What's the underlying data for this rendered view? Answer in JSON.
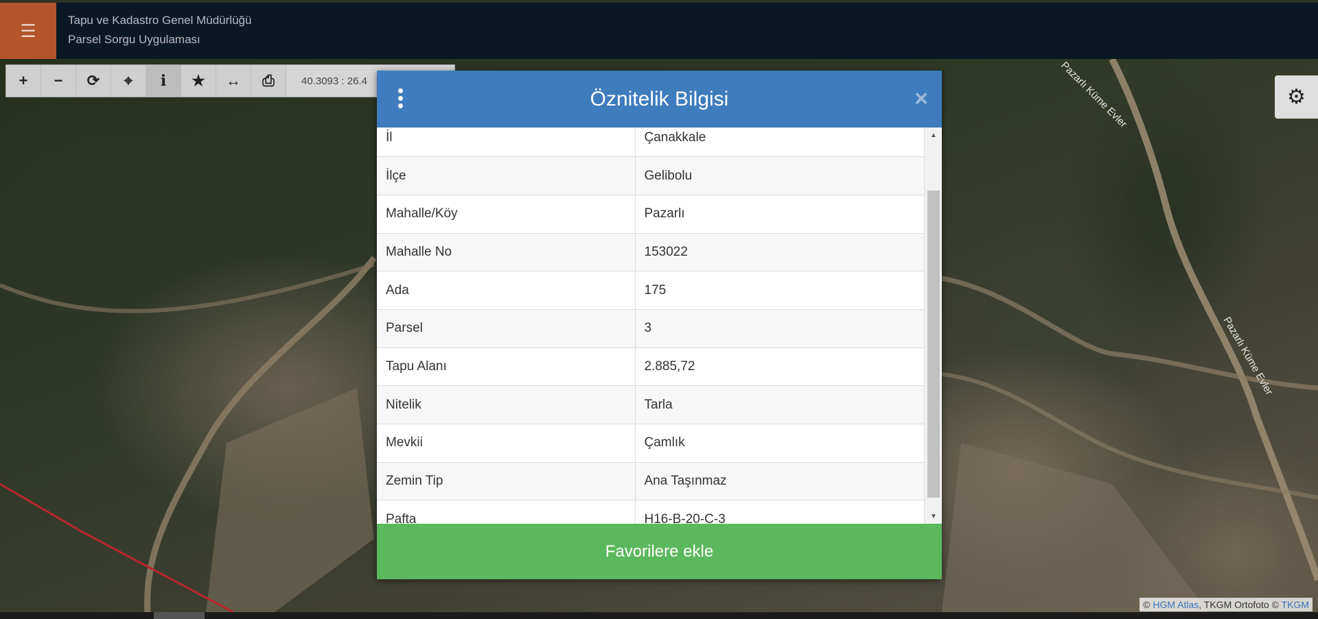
{
  "header": {
    "title_line1": "Tapu ve Kadastro Genel Müdürlüğü",
    "title_line2": "Parsel Sorgu Uygulaması",
    "menu_icon": "hamburger-icon"
  },
  "toolbar": {
    "tools": [
      "zoom-in-icon",
      "zoom-out-icon",
      "refresh-icon",
      "locate-icon",
      "info-icon",
      "favorite-icon",
      "measure-icon",
      "print-icon"
    ],
    "coordinates": "40.3093 : 26.4"
  },
  "settings": {
    "icon": "gear-icon"
  },
  "modal": {
    "title": "Öznitelik Bilgisi",
    "close_glyph": "×",
    "rows": [
      {
        "key": "İl",
        "value": "Çanakkale"
      },
      {
        "key": "İlçe",
        "value": "Gelibolu"
      },
      {
        "key": "Mahalle/Köy",
        "value": "Pazarlı"
      },
      {
        "key": "Mahalle No",
        "value": "153022"
      },
      {
        "key": "Ada",
        "value": "175"
      },
      {
        "key": "Parsel",
        "value": "3"
      },
      {
        "key": "Tapu Alanı",
        "value": "2.885,72"
      },
      {
        "key": "Nitelik",
        "value": "Tarla"
      },
      {
        "key": "Mevkii",
        "value": "Çamlık"
      },
      {
        "key": "Zemin Tip",
        "value": "Ana Taşınmaz"
      },
      {
        "key": "Pafta",
        "value": "H16-B-20-C-3"
      }
    ],
    "favorite_button": "Favorilere ekle"
  },
  "map": {
    "road_label_1": "Pazarlı Küme Evler",
    "road_label_2": "Pazarlı Küme Evler"
  },
  "attribution": {
    "prefix": "© ",
    "link1": "HGM Atlas",
    "middle": ", TKGM Ortofoto © ",
    "link2": "TKGM"
  }
}
